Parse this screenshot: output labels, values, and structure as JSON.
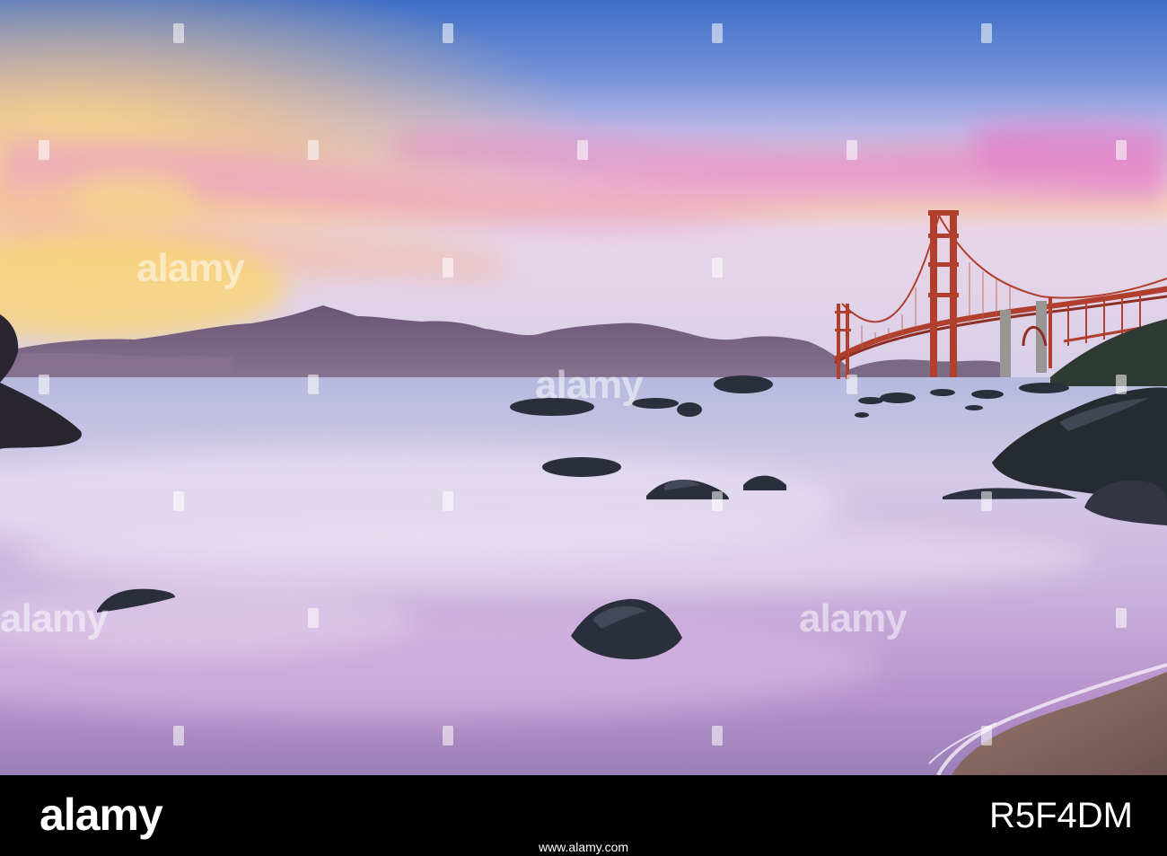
{
  "photo": {
    "subject": "Golden Gate Bridge at sunset over misty shoreline",
    "palette": {
      "sky_top": "#3f73c9",
      "sky_mid": "#aeb4e4",
      "sky_glow": "#f7c88a",
      "horizon_yellow": "#f9d57a",
      "cloud_pink": "#e79ac8",
      "hills": "#6c5a78",
      "water": "#c7b8df",
      "bridge": "#b2402f",
      "rocks": "#2b2f3c",
      "sand": "#8b6a62"
    }
  },
  "watermark": {
    "text": "alamy"
  },
  "footer": {
    "brand": "alamy",
    "image_id": "R5F4DM",
    "link": "www.alamy.com"
  }
}
